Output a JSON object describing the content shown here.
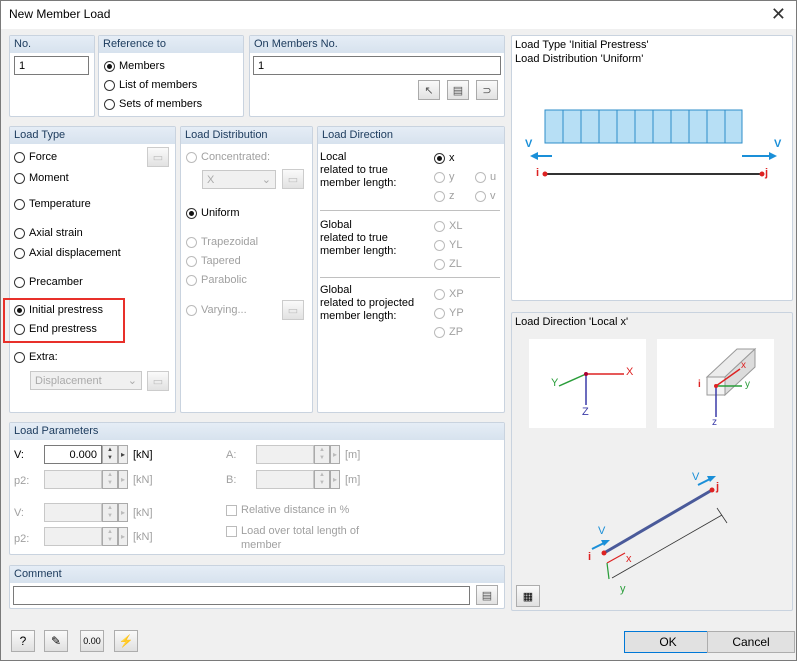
{
  "window": {
    "title": "New Member Load"
  },
  "no": {
    "header": "No.",
    "value": "1"
  },
  "reference": {
    "header": "Reference to",
    "members": "Members",
    "list_of_members": "List of members",
    "sets_of_members": "Sets of members"
  },
  "on_members": {
    "header": "On Members No.",
    "value": "1"
  },
  "load_type": {
    "header": "Load Type",
    "force": "Force",
    "moment": "Moment",
    "temperature": "Temperature",
    "axial_strain": "Axial strain",
    "axial_displacement": "Axial displacement",
    "precamber": "Precamber",
    "initial_prestress": "Initial prestress",
    "end_prestress": "End prestress",
    "extra": "Extra:",
    "extra_value": "Displacement"
  },
  "load_distribution": {
    "header": "Load Distribution",
    "concentrated": "Concentrated:",
    "concentrated_value": "X",
    "uniform": "Uniform",
    "trapezoidal": "Trapezoidal",
    "tapered": "Tapered",
    "parabolic": "Parabolic",
    "varying": "Varying..."
  },
  "load_direction": {
    "header": "Load Direction",
    "local_label": "Local\nrelated to true\nmember length:",
    "global_true_label": "Global\nrelated to true\nmember length:",
    "global_proj_label": "Global\nrelated to projected\nmember length:",
    "x": "x",
    "y": "y",
    "z": "z",
    "u": "u",
    "v": "v",
    "XL": "XL",
    "YL": "YL",
    "ZL": "ZL",
    "XP": "XP",
    "YP": "YP",
    "ZP": "ZP"
  },
  "load_parameters": {
    "header": "Load Parameters",
    "V_label": "V:",
    "V_value": "0.000",
    "V_unit": "[kN]",
    "p2_label": "p2:",
    "p2_unit": "[kN]",
    "V2_label": "V:",
    "V2_unit": "[kN]",
    "p2b_label": "p2:",
    "p2b_unit": "[kN]",
    "A_label": "A:",
    "A_unit": "[m]",
    "B_label": "B:",
    "B_unit": "[m]",
    "relative_distance": "Relative distance in %",
    "load_over_total_1": "Load over total length of",
    "load_over_total_2": "member"
  },
  "comment": {
    "header": "Comment",
    "value": ""
  },
  "preview": {
    "top_title_1": "Load Type 'Initial Prestress'",
    "top_title_2": "Load Distribution 'Uniform'",
    "bottom_title": "Load Direction 'Local x'",
    "label_V": "V",
    "label_i": "i",
    "label_j": "j",
    "axis_X": "X",
    "axis_Y": "Y",
    "axis_Z": "Z",
    "axis_x": "x",
    "axis_y": "y",
    "axis_z": "z"
  },
  "buttons": {
    "ok": "OK",
    "cancel": "Cancel"
  },
  "colors": {
    "highlight": "#e8302a",
    "load_fill": "#b7dff5",
    "arrow_blue": "#1a8fd8"
  }
}
